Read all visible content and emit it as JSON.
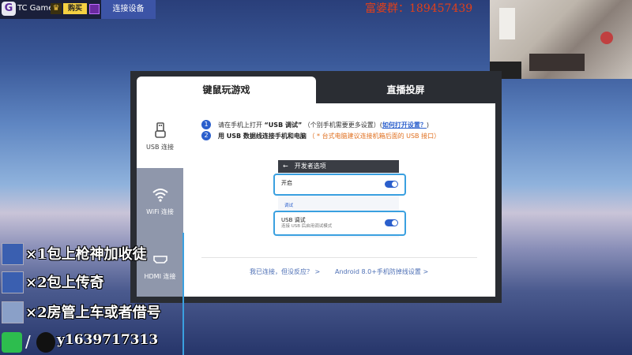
{
  "topbar": {
    "logo_letter": "G",
    "app_name": "TC Games",
    "buy_label": "购买",
    "active_tab": "连接设备"
  },
  "qq_group": "富婆群：189457439",
  "dialog": {
    "tabs": [
      "键鼠玩游戏",
      "直播投屏"
    ],
    "sidebar": [
      {
        "label": "USB 连接",
        "icon": "usb-icon"
      },
      {
        "label": "WiFi 连接",
        "icon": "wifi-icon"
      },
      {
        "label": "HDMI 连接",
        "icon": "hdmi-icon"
      }
    ],
    "steps": [
      {
        "num": "1",
        "text_a": "请在手机上打开",
        "text_b": "“USB 调试”",
        "text_c": "（个别手机需要更多设置）(",
        "link": "如何打开设置？",
        "text_d": ")"
      },
      {
        "num": "2",
        "text_a": "用 USB 数据线连接手机和电脑",
        "warn": "（ * 台式电脑建议连接机箱后面的 USB 接口）"
      }
    ],
    "phone": {
      "header": "开发者选项",
      "back_icon": "arrow-left-icon",
      "row1_label": "开启",
      "section_label": "调试",
      "row2_label": "USB 调试",
      "row2_sub": "连接 USB 后启用调试模式"
    },
    "footer_links": [
      "我已连接，但没反应？ >",
      "Android 8.0+手机防掉线设置 >"
    ]
  },
  "promo": [
    {
      "text": "×1包上枪神加收徒"
    },
    {
      "text": "×2包上传奇"
    },
    {
      "text": "×2房管上车或者借号"
    }
  ],
  "contact": {
    "slash": "/",
    "qq_number": "y1639717313"
  },
  "colors": {
    "accent": "#2b5fcc",
    "highlight": "#3aa0e0",
    "warning": "#e07020",
    "qq_red": "#e0401a"
  }
}
